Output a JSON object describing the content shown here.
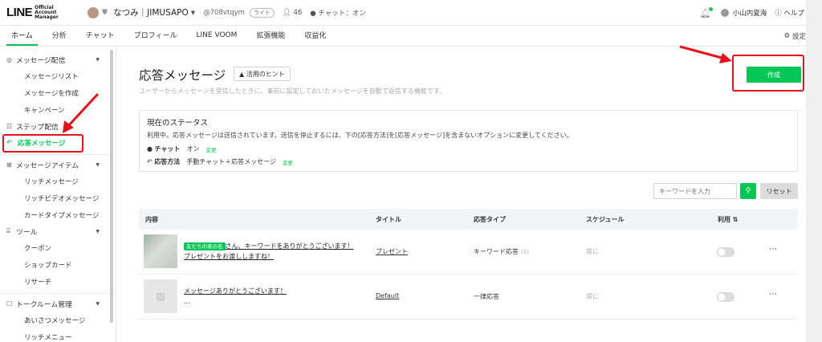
{
  "header": {
    "logo_main": "LINE",
    "logo_sub": "Official Account Manager",
    "account_name": "なつみ｜JIMUSAPO",
    "account_id": "@708vtqym",
    "plan": "ライト",
    "friends_count": "46",
    "chat_status": "チャット：オン",
    "user_name": "小山内夏海",
    "help": "ヘルプ"
  },
  "nav": {
    "tabs": [
      "ホーム",
      "分析",
      "チャット",
      "プロフィール",
      "LINE VOOM",
      "拡張機能",
      "収益化"
    ],
    "settings": "設定"
  },
  "sidebar": {
    "section1": "メッセージ配信",
    "items1": [
      "メッセージリスト",
      "メッセージを作成",
      "キャンペーン"
    ],
    "step": "ステップ配信",
    "active": "応答メッセージ",
    "section2": "メッセージアイテム",
    "items2": [
      "リッチメッセージ",
      "リッチビデオメッセージ",
      "カードタイプメッセージ"
    ],
    "section3": "ツール",
    "items3": [
      "クーポン",
      "ショップカード",
      "リサーチ"
    ],
    "section4": "トークルーム管理",
    "items4": [
      "あいさつメッセージ",
      "リッチメニュー"
    ]
  },
  "main": {
    "title": "応答メッセージ",
    "hint_button": "活用のヒント",
    "description": "ユーザーからメッセージを受信したときに、事前に設定しておいたメッセージを自動で返信する機能です。",
    "create_button": "作成",
    "status": {
      "title": "現在のステータス",
      "description": "利用中。応答メッセージは送信されています。送信を停止するには、下の[応答方法]を[応答メッセージ]を含まないオプションに変更してください。",
      "chat_label": "チャット",
      "chat_value": "オン",
      "method_label": "応答方法",
      "method_value": "手動チャット＋応答メッセージ",
      "change": "変更"
    },
    "search": {
      "placeholder": "キーワードを入力",
      "reset": "リセット"
    },
    "table": {
      "headers": [
        "内容",
        "タイトル",
        "応答タイプ",
        "スケジュール",
        "利用"
      ],
      "rows": [
        {
          "tag": "友だちの表示名",
          "content_line1": "さん、キーワードをありがとうございます！",
          "content_line2": "プレゼントをお渡ししますね！",
          "title": "プレゼント",
          "type": "キーワード応答",
          "count": "(1)",
          "schedule": "常に"
        },
        {
          "content_line1": "メッセージありがとうございます！",
          "content_line2": "...",
          "title": "Default",
          "type": "一律応答",
          "schedule": "常に"
        }
      ]
    }
  },
  "colors": {
    "accent": "#06c755",
    "highlight": "#e8111b"
  }
}
